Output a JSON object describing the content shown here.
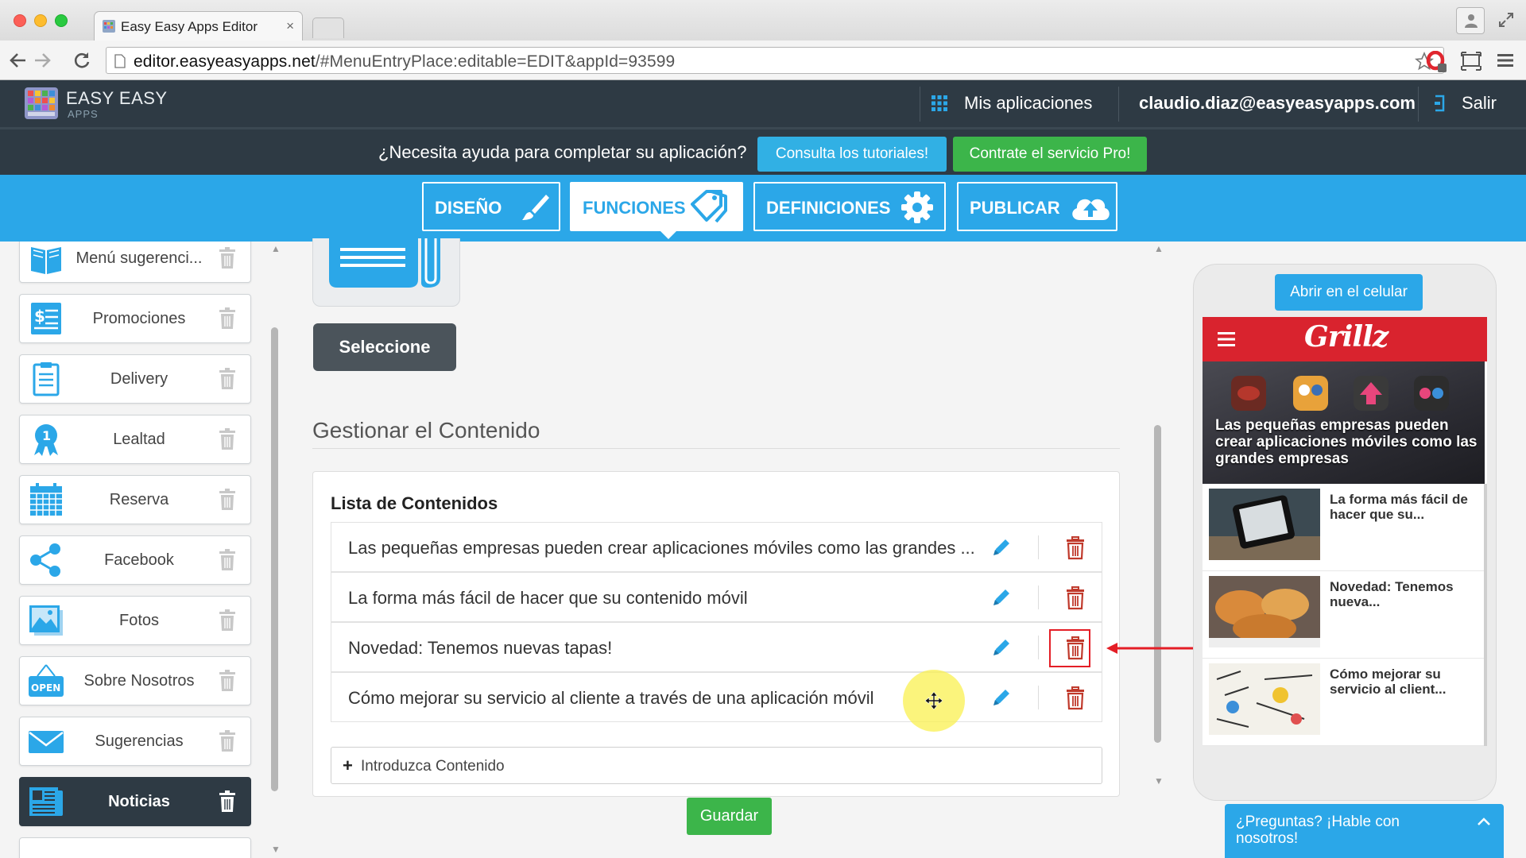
{
  "browser": {
    "tab_title": "Easy Easy Apps Editor",
    "tab_close": "×",
    "url_host": "editor.easyeasyapps.net",
    "url_path": "/#MenuEntryPlace:editable=EDIT&appId=93599"
  },
  "header": {
    "logo_title": "EASY EASY",
    "logo_sub": "APPS",
    "my_apps": "Mis aplicaciones",
    "user_email": "claudio.diaz@easyeasyapps.com",
    "logout": "Salir"
  },
  "help_bar": {
    "question": "¿Necesita ayuda para completar su aplicación?",
    "tutorials_button": "Consulta los tutoriales!",
    "pro_button": "Contrate el servicio Pro!"
  },
  "main_tabs": [
    {
      "label": "DISEÑO",
      "icon": "brush-icon"
    },
    {
      "label": "FUNCIONES",
      "icon": "tags-icon",
      "active": true
    },
    {
      "label": "DEFINICIONES",
      "icon": "gear-icon"
    },
    {
      "label": "PUBLICAR",
      "icon": "cloud-upload-icon"
    }
  ],
  "sidebar": {
    "items": [
      {
        "label": "Menú sugerenci...",
        "icon": "book-icon"
      },
      {
        "label": "Promociones",
        "icon": "coupon-icon"
      },
      {
        "label": "Delivery",
        "icon": "clipboard-icon"
      },
      {
        "label": "Lealtad",
        "icon": "ribbon-icon"
      },
      {
        "label": "Reserva",
        "icon": "calendar-icon"
      },
      {
        "label": "Facebook",
        "icon": "share-icon"
      },
      {
        "label": "Fotos",
        "icon": "photo-icon"
      },
      {
        "label": "Sobre Nosotros",
        "icon": "open-sign-icon"
      },
      {
        "label": "Sugerencias",
        "icon": "envelope-icon"
      },
      {
        "label": "Noticias",
        "icon": "newspaper-icon",
        "active": true
      }
    ]
  },
  "editor": {
    "select_button": "Seleccione",
    "section_title": "Gestionar el Contenido",
    "list_title": "Lista de Contenidos",
    "items": [
      "Las pequeñas empresas pueden crear aplicaciones móviles como las grandes ...",
      "La forma más fácil de hacer que su contenido móvil",
      "Novedad: Tenemos nuevas tapas!",
      "Cómo mejorar su servicio al cliente a través de una aplicación móvil"
    ],
    "add_plus": "+",
    "add_content": "Introduzca Contenido",
    "save_button": "Guardar"
  },
  "preview": {
    "open_on_phone": "Abrir en el celular",
    "brand": "Grillz",
    "hero_title": "Las pequeñas empresas pueden crear aplicaciones móviles como las grandes empresas",
    "cards": [
      "La forma más fácil de hacer que su...",
      "Novedad: Tenemos nueva...",
      "Cómo mejorar su servicio al client..."
    ]
  },
  "chat": {
    "label": "¿Preguntas? ¡Hable con nosotros!"
  },
  "colors": {
    "primary_blue": "#2ba7e8",
    "dark_header": "#2e3a44",
    "green": "#3cb54a",
    "delete_red": "#c0392b",
    "brand_red": "#d9232e"
  }
}
